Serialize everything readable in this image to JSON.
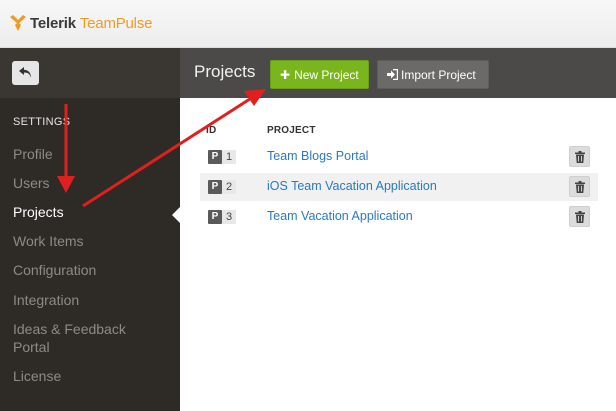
{
  "brand": {
    "name": "Telerik",
    "product": "TeamPulse",
    "accent": "#f39a1e"
  },
  "sidebar": {
    "heading": "SETTINGS",
    "items": [
      {
        "label": "Profile",
        "active": false
      },
      {
        "label": "Users",
        "active": false
      },
      {
        "label": "Projects",
        "active": true
      },
      {
        "label": "Work Items",
        "active": false
      },
      {
        "label": "Configuration",
        "active": false
      },
      {
        "label": "Integration",
        "active": false
      },
      {
        "label": "Ideas & Feedback Portal",
        "active": false
      },
      {
        "label": "License",
        "active": false
      }
    ]
  },
  "toolbar": {
    "title": "Projects",
    "new_project_label": "New Project",
    "import_project_label": "Import Project",
    "new_color": "#7ab51d"
  },
  "table": {
    "columns": [
      "ID",
      "PROJECT"
    ],
    "rows": [
      {
        "badge": "P",
        "id": "1",
        "name": "Team Blogs Portal"
      },
      {
        "badge": "P",
        "id": "2",
        "name": "iOS Team Vacation Application"
      },
      {
        "badge": "P",
        "id": "3",
        "name": "Team Vacation Application"
      }
    ]
  },
  "icons": {
    "back": "undo-arrow-icon",
    "new": "plus-icon",
    "import": "import-icon",
    "delete": "trash-icon"
  },
  "annotation_color": "#e02020"
}
